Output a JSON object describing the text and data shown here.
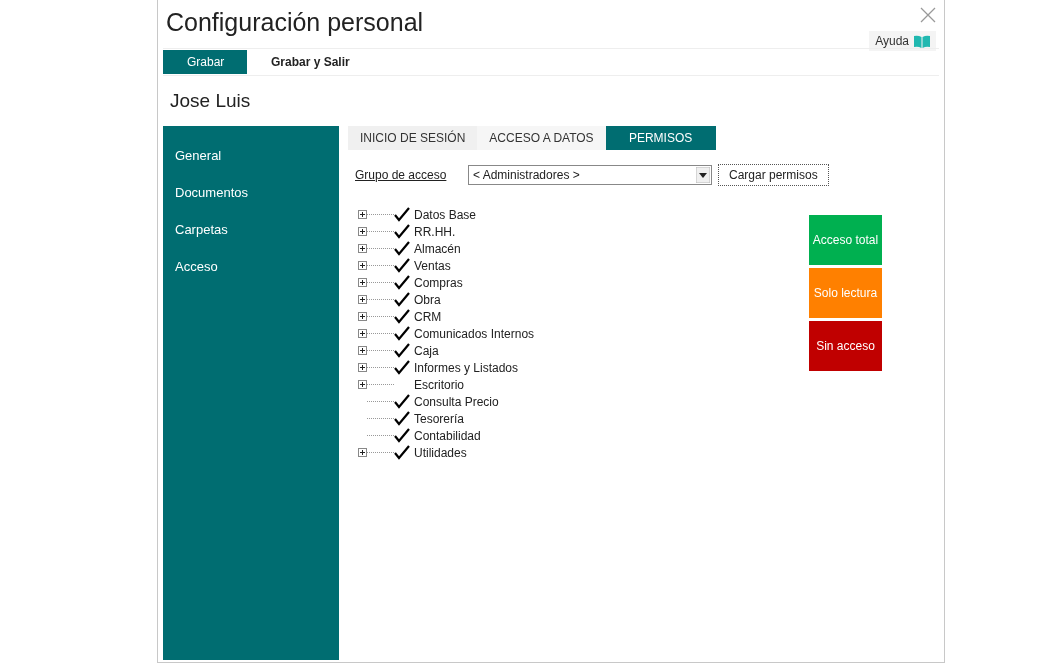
{
  "window": {
    "title": "Configuración personal",
    "help": "Ayuda"
  },
  "toolbar": [
    {
      "label": "Grabar",
      "selected": true
    },
    {
      "label": "Grabar y Salir",
      "selected": false
    }
  ],
  "user_name": "Jose Luis",
  "sidebar": {
    "items": [
      {
        "label": "General"
      },
      {
        "label": "Documentos"
      },
      {
        "label": "Carpetas"
      },
      {
        "label": "Acceso"
      }
    ]
  },
  "tabs": [
    {
      "label": "INICIO DE SESIÓN",
      "selected": false
    },
    {
      "label": "ACCESO A DATOS",
      "selected": false
    },
    {
      "label": "PERMISOS",
      "selected": true
    }
  ],
  "access_group": {
    "label": "Grupo de acceso",
    "value": "< Administradores >",
    "button": "Cargar permisos"
  },
  "tree": [
    {
      "label": "Datos Base",
      "checked": true,
      "expandable": true
    },
    {
      "label": "RR.HH.",
      "checked": true,
      "expandable": true
    },
    {
      "label": "Almacén",
      "checked": true,
      "expandable": true
    },
    {
      "label": "Ventas",
      "checked": true,
      "expandable": true
    },
    {
      "label": "Compras",
      "checked": true,
      "expandable": true
    },
    {
      "label": "Obra",
      "checked": true,
      "expandable": true
    },
    {
      "label": "CRM",
      "checked": true,
      "expandable": true
    },
    {
      "label": "Comunicados Internos",
      "checked": true,
      "expandable": true
    },
    {
      "label": "Caja",
      "checked": true,
      "expandable": true
    },
    {
      "label": "Informes y Listados",
      "checked": true,
      "expandable": true
    },
    {
      "label": "Escritorio",
      "checked": false,
      "expandable": true
    },
    {
      "label": "Consulta Precio",
      "checked": true,
      "expandable": false
    },
    {
      "label": "Tesorería",
      "checked": true,
      "expandable": false
    },
    {
      "label": "Contabilidad",
      "checked": true,
      "expandable": false
    },
    {
      "label": "Utilidades",
      "checked": true,
      "expandable": true
    }
  ],
  "legend": [
    {
      "label": "Acceso total",
      "color": "#00b050"
    },
    {
      "label": "Solo lectura",
      "color": "#ff8000"
    },
    {
      "label": "Sin acceso",
      "color": "#c00000"
    }
  ]
}
